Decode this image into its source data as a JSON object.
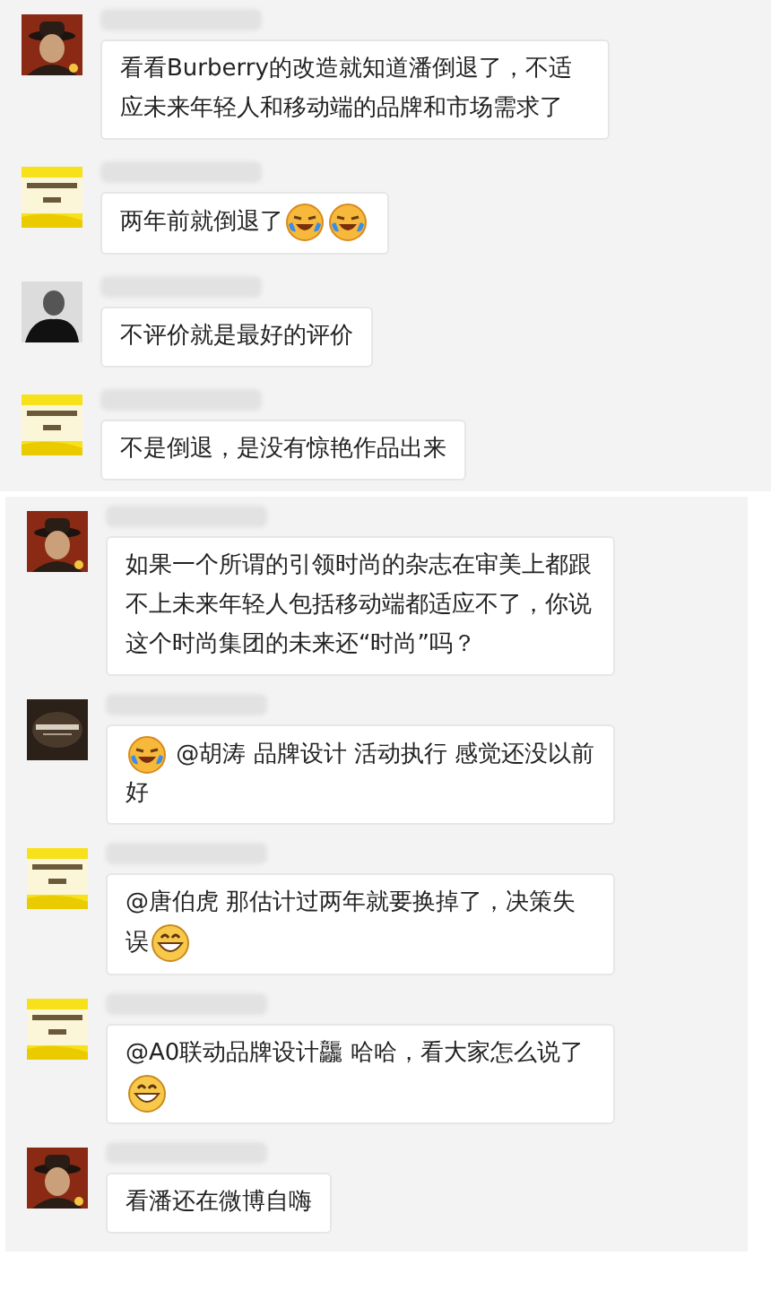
{
  "sections": [
    {
      "messages": [
        {
          "avatar": {
            "kind": "hat"
          },
          "parts": [
            {
              "kind": "text",
              "text": "看看Burberry的改造就知道潘倒退了，不适应未来年轻人和移动端的品牌和市场需求了"
            }
          ]
        },
        {
          "avatar": {
            "kind": "yellow_logo"
          },
          "parts": [
            {
              "kind": "text",
              "text": "两年前就倒退了"
            },
            {
              "kind": "cry_laugh"
            },
            {
              "kind": "cry_laugh"
            }
          ]
        },
        {
          "avatar": {
            "kind": "dark_figure"
          },
          "parts": [
            {
              "kind": "text",
              "text": "不评价就是最好的评价"
            }
          ]
        },
        {
          "avatar": {
            "kind": "yellow_logo"
          },
          "parts": [
            {
              "kind": "text",
              "text": "不是倒退，是没有惊艳作品出来"
            }
          ]
        }
      ]
    },
    {
      "messages": [
        {
          "avatar": {
            "kind": "hat"
          },
          "parts": [
            {
              "kind": "text",
              "text": "如果一个所谓的引领时尚的杂志在审美上都跟不上未来年轻人包括移动端都适应不了，你说这个时尚集团的未来还“时尚”吗？"
            }
          ]
        },
        {
          "avatar": {
            "kind": "brown_logo"
          },
          "parts": [
            {
              "kind": "cry_laugh"
            },
            {
              "kind": "text",
              "text": " @胡涛 品牌设计 活动执行  感觉还没以前好"
            }
          ]
        },
        {
          "avatar": {
            "kind": "yellow_logo"
          },
          "parts": [
            {
              "kind": "text",
              "text": "@唐伯虎 那估计过两年就要换掉了，决策失误"
            },
            {
              "kind": "grin"
            }
          ]
        },
        {
          "avatar": {
            "kind": "yellow_logo"
          },
          "parts": [
            {
              "kind": "text",
              "text": "@A0联动品牌设计龘 哈哈，看大家怎么说了"
            },
            {
              "kind": "grin"
            }
          ]
        },
        {
          "avatar": {
            "kind": "hat"
          },
          "parts": [
            {
              "kind": "text",
              "text": "看潘还在微博自嗨"
            }
          ]
        }
      ]
    }
  ]
}
